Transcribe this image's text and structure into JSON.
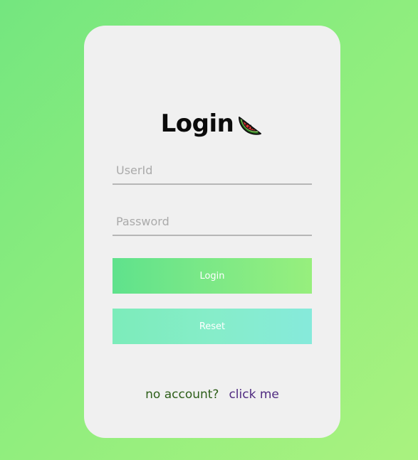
{
  "login_card": {
    "title": "Login",
    "title_icon": "watermelon-slice-icon",
    "userid": {
      "placeholder": "UserId",
      "value": ""
    },
    "password": {
      "placeholder": "Password",
      "value": ""
    },
    "login_button_label": "Login",
    "reset_button_label": "Reset",
    "footer": {
      "prompt": "no account?",
      "link": "click me"
    }
  },
  "colors": {
    "background_gradient_start": "#74e67f",
    "background_gradient_end": "#a9f27f",
    "card_background": "#f0f0f0",
    "login_button_start": "#5fe28c",
    "login_button_end": "#97ef7d",
    "reset_button_start": "#7cecba",
    "reset_button_end": "#86eadb",
    "footer_prompt": "#2d5e19",
    "footer_link": "#4f2a80"
  }
}
